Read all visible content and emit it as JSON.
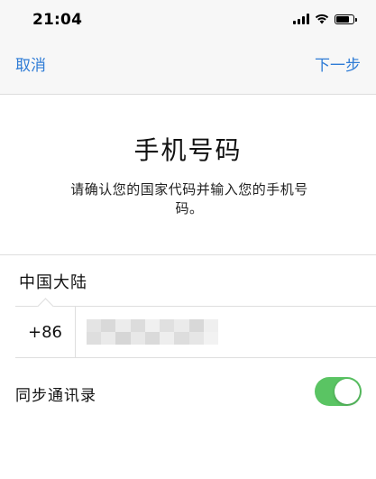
{
  "status_bar": {
    "time": "21:04",
    "icons": [
      "cellular-signal-icon",
      "wifi-icon",
      "battery-icon"
    ]
  },
  "nav": {
    "cancel_label": "取消",
    "next_label": "下一步"
  },
  "main": {
    "title": "手机号码",
    "subtitle": "请确认您的国家代码并输入您的手机号码。"
  },
  "form": {
    "country": "中国大陆",
    "country_code": "+86",
    "phone_value_state": "blurred"
  },
  "sync": {
    "label": "同步通讯录",
    "enabled": true
  },
  "colors": {
    "accent": "#2f7cd6",
    "toggle_on": "#5ac463",
    "bar_bg": "#f7f7f7",
    "separator": "#dedede"
  }
}
